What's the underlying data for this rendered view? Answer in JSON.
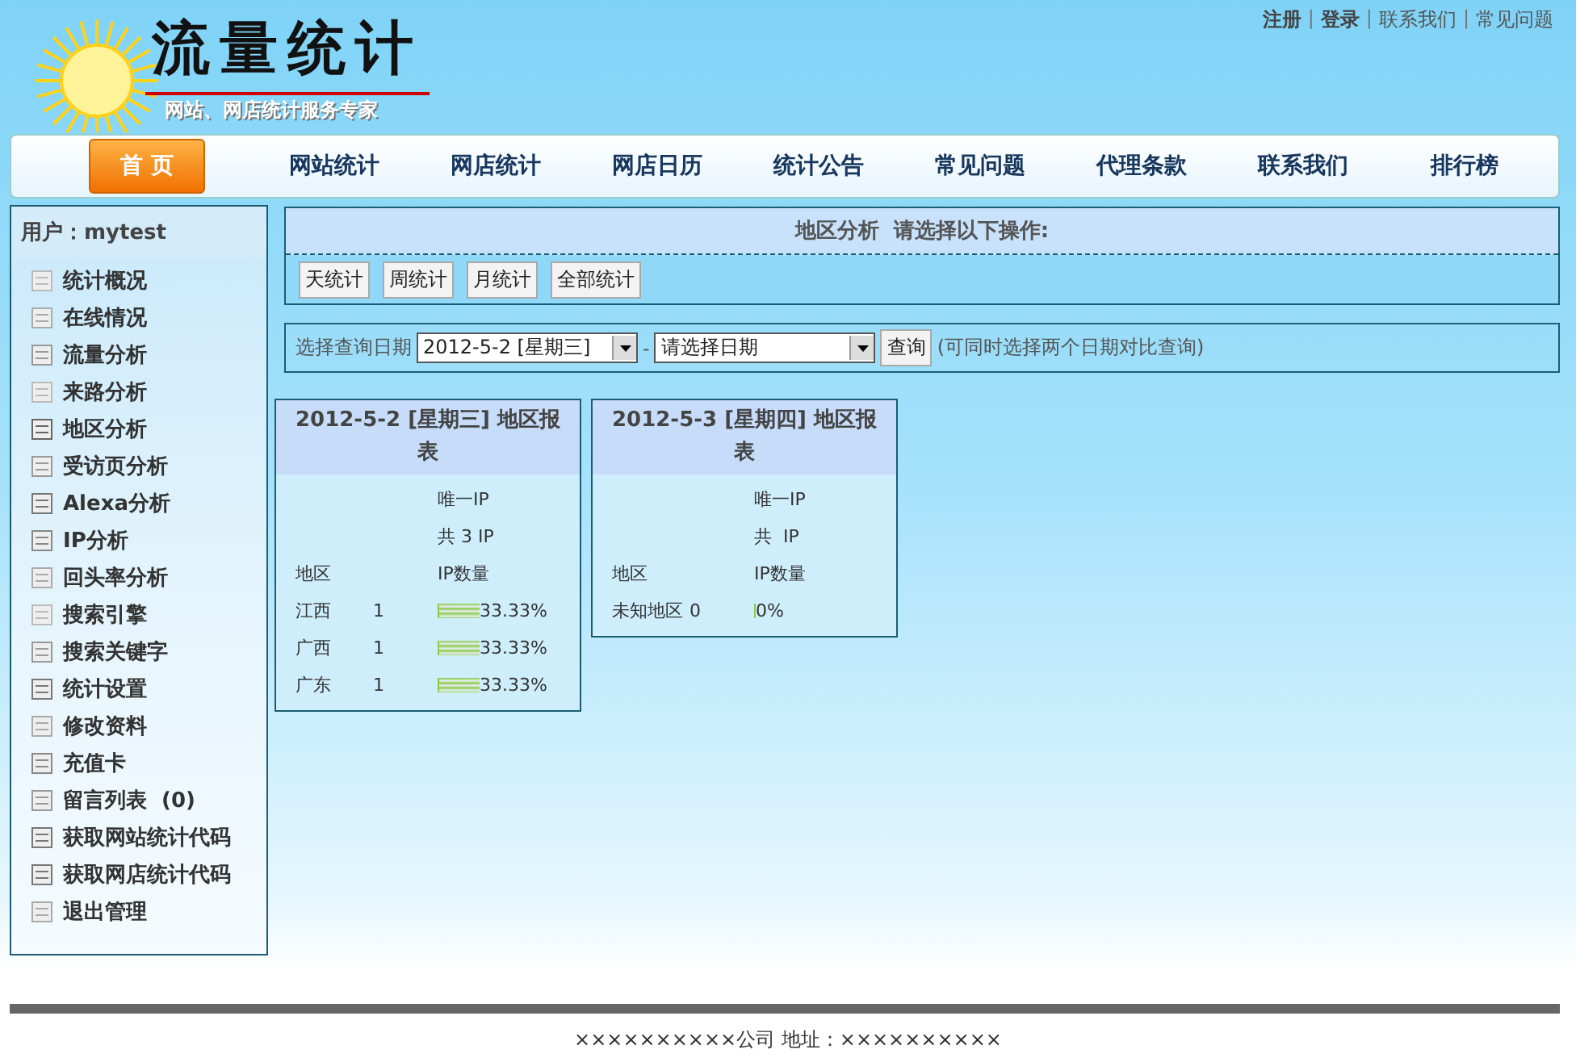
{
  "header": {
    "logo_text": "流量统计",
    "slogan": "网站、网店统计服务专家",
    "separator": "|",
    "top_links": [
      {
        "label": "注册",
        "bold": true
      },
      {
        "label": "登录",
        "bold": true
      },
      {
        "label": "联系我们",
        "bold": false
      },
      {
        "label": "常见问题",
        "bold": false
      }
    ]
  },
  "nav": [
    {
      "label": "首 页",
      "selected": true
    },
    {
      "label": "网站统计",
      "selected": false
    },
    {
      "label": "网店统计",
      "selected": false
    },
    {
      "label": "网店日历",
      "selected": false
    },
    {
      "label": "统计公告",
      "selected": false
    },
    {
      "label": "常见问题",
      "selected": false
    },
    {
      "label": "代理条款",
      "selected": false
    },
    {
      "label": "联系我们",
      "selected": false
    },
    {
      "label": "排行榜",
      "selected": false
    }
  ],
  "sidebar": {
    "user": "用户：mytest",
    "items": [
      {
        "label": "统计概况"
      },
      {
        "label": "在线情况"
      },
      {
        "label": "流量分析"
      },
      {
        "label": "来路分析"
      },
      {
        "label": "地区分析"
      },
      {
        "label": "受访页分析"
      },
      {
        "label": "Alexa分析"
      },
      {
        "label": "IP分析"
      },
      {
        "label": "回头率分析"
      },
      {
        "label": "搜索引擎"
      },
      {
        "label": "搜索关键字"
      },
      {
        "label": "统计设置"
      },
      {
        "label": "修改资料"
      },
      {
        "label": "充值卡"
      },
      {
        "label": "留言列表  (0)"
      },
      {
        "label": "获取网站统计代码"
      },
      {
        "label": "获取网店统计代码"
      },
      {
        "label": "退出管理"
      }
    ]
  },
  "panel": {
    "title": "地区分析  请选择以下操作:",
    "buttons": [
      "天统计",
      "周统计",
      "月统计",
      "全部统计"
    ]
  },
  "query": {
    "label": "选择查询日期",
    "date1": "2012-5-2 [星期三]",
    "separator": "-",
    "date2": "请选择日期",
    "button": "查询",
    "hint": "(可同时选择两个日期对比查询)"
  },
  "reports": [
    {
      "title": "2012-5-2 [星期三] 地区报表",
      "unique_ip": "唯一IP",
      "total": "共 3 IP",
      "region_header": "地区",
      "ip_header": "IP数量",
      "rows": [
        {
          "region": "江西",
          "count": "1",
          "percent": "33.33%",
          "level": 0.3333
        },
        {
          "region": "广西",
          "count": "1",
          "percent": "33.33%",
          "level": 0.3333
        },
        {
          "region": "广东",
          "count": "1",
          "percent": "33.33%",
          "level": 0.3333
        }
      ]
    },
    {
      "title": "2012-5-3 [星期四] 地区报表",
      "unique_ip": "唯一IP",
      "total": "共  IP",
      "region_header": "地区",
      "ip_header": "IP数量",
      "rows": [
        {
          "region": "未知地区",
          "count": "0",
          "percent": "0%",
          "level": 0
        }
      ]
    }
  ],
  "footer": {
    "company": "××××××××××公司 地址：××××××××××"
  }
}
